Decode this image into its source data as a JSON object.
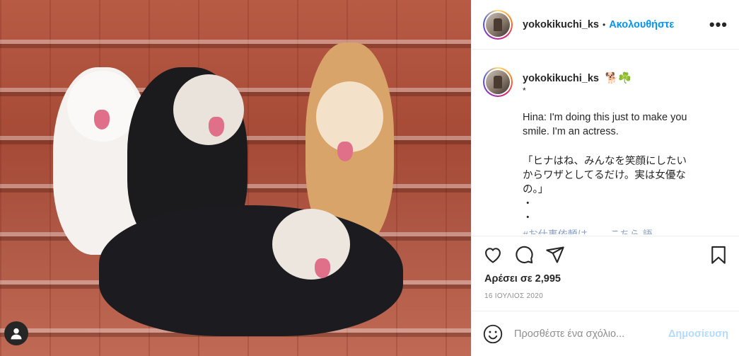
{
  "post": {
    "username": "yokokikuchi_ks",
    "follow_dot": "•",
    "follow_label": "Ακολουθήστε",
    "more_label": "•••"
  },
  "caption": {
    "username": "yokokikuchi_ks",
    "emoji": "🐕☘️",
    "star": "*",
    "line1": "Hina: I'm doing this just to make you",
    "line2": "smile. I'm an actress.",
    "jp1": "「ヒナはね、みんなを笑顔にしたい",
    "jp2": "からワザとしてるだけ。実は女優な",
    "jp3": "の。」",
    "dot1": "・",
    "dot2": "・",
    "cut": "#お仕事依頼は…… こちら 語"
  },
  "stats": {
    "likes": "Αρέσει σε 2,995",
    "date": "16 ΙΟΥΛΙΟΣ 2020"
  },
  "comment": {
    "placeholder": "Προσθέστε ένα σχόλιο...",
    "post_label": "Δημοσίευση"
  },
  "colors": {
    "accent": "#0095f6",
    "post_disabled": "#b3dbff",
    "text": "#262626",
    "muted": "#8e8e8e"
  },
  "icons": [
    "heart-icon",
    "comment-icon",
    "share-icon",
    "bookmark-icon",
    "smiley-icon",
    "more-icon",
    "user-icon"
  ]
}
